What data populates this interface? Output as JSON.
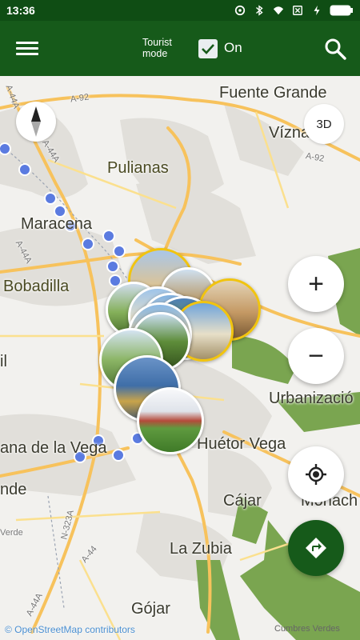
{
  "status_bar": {
    "time": "13:36"
  },
  "app_bar": {
    "tourist_mode_label_line1": "Tourist",
    "tourist_mode_label_line2": "mode",
    "toggle_label": "On",
    "toggle_checked": true
  },
  "map": {
    "places": {
      "fuente_grande": "Fuente Grande",
      "viznar": "Víznar",
      "pulianas": "Pulianas",
      "maracena": "Maracena",
      "bobadilla": "Bobadilla",
      "il": "il",
      "urbanizacion": "Urbanizació",
      "ana_de_la_vega": "ana de la Vega",
      "huetor_vega": "Huétor Vega",
      "nde": "nde",
      "cajar": "Cájar",
      "monach": "Monach",
      "la_zubia": "La Zubia",
      "gojar": "Gójar",
      "verde": "Verde"
    },
    "roads": {
      "a92_top": "A-92",
      "a92_right": "A-92",
      "a44a_top": "A-44A",
      "a44a_left": "A-44A",
      "a44a_mid": "A-44A",
      "a44a_bottom": "A-44A",
      "n323a": "N-323A",
      "a44_top": "A-44"
    }
  },
  "controls": {
    "three_d_label": "3D",
    "zoom_in_label": "+",
    "zoom_out_label": "−"
  },
  "attribution": {
    "osm": "© OpenStreetMap contributors",
    "cumbres": "Cumbres Verdes"
  },
  "colors": {
    "app_bar": "#165a1a",
    "status_bar": "#0f4d14",
    "road_major": "#f7c25c",
    "road_minor": "#fbe08e",
    "park": "#7aa550"
  }
}
